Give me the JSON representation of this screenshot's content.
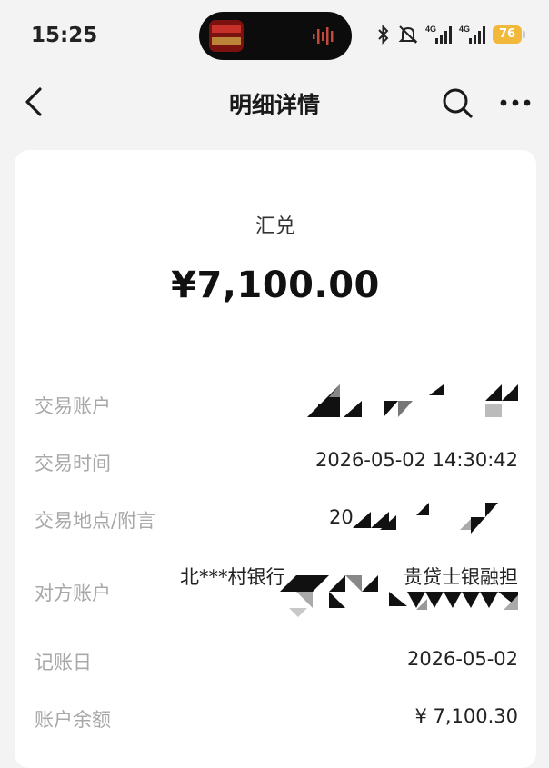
{
  "status_bar": {
    "time": "15:25",
    "battery": "76",
    "network": [
      "4G",
      "4G"
    ],
    "icons": [
      "bluetooth-icon",
      "mute-icon",
      "signal-icon",
      "signal-icon"
    ]
  },
  "nav": {
    "title": "明细详情",
    "back_icon": "chevron-left-icon",
    "search_icon": "search-icon",
    "more_icon": "more-icon"
  },
  "detail": {
    "type": "汇兑",
    "amount": "¥7,100.00",
    "rows": [
      {
        "label": "交易账户",
        "value": ""
      },
      {
        "label": "交易时间",
        "value": "2026-05-02 14:30:42"
      },
      {
        "label": "交易地点/附言",
        "value": "20"
      },
      {
        "label": "对方账户",
        "value": "北***村银行",
        "value2": "贵贷士银融担"
      },
      {
        "label": "记账日",
        "value": "2026-05-02"
      },
      {
        "label": "账户余额",
        "value": "¥ 7,100.30"
      }
    ]
  },
  "colors": {
    "background": "#f3f3f3",
    "card": "#ffffff",
    "label": "#a8a8a8",
    "battery": "#f2b83a"
  }
}
